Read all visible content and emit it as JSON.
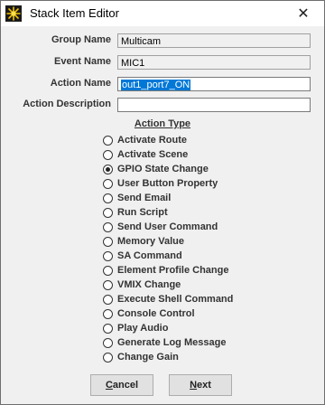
{
  "window": {
    "title": "Stack Item Editor",
    "close_symbol": "✕",
    "icon": "starburst-icon"
  },
  "form": {
    "group_name": {
      "label": "Group Name",
      "value": "Multicam"
    },
    "event_name": {
      "label": "Event Name",
      "value": "MIC1"
    },
    "action_name": {
      "label": "Action Name",
      "value": "out1_port7_ON"
    },
    "action_description": {
      "label": "Action Description",
      "value": ""
    }
  },
  "action_type": {
    "title": "Action Type",
    "selected": "GPIO State Change",
    "options": [
      "Activate Route",
      "Activate Scene",
      "GPIO State Change",
      "User Button Property",
      "Send Email",
      "Run Script",
      "Send User Command",
      "Memory Value",
      "SA Command",
      "Element Profile Change",
      "VMIX Change",
      "Execute Shell Command",
      "Console Control",
      "Play Audio",
      "Generate Log Message",
      "Change Gain"
    ]
  },
  "buttons": {
    "cancel": {
      "mnemonic": "C",
      "rest": "ancel"
    },
    "next": {
      "mnemonic": "N",
      "rest": "ext"
    }
  }
}
